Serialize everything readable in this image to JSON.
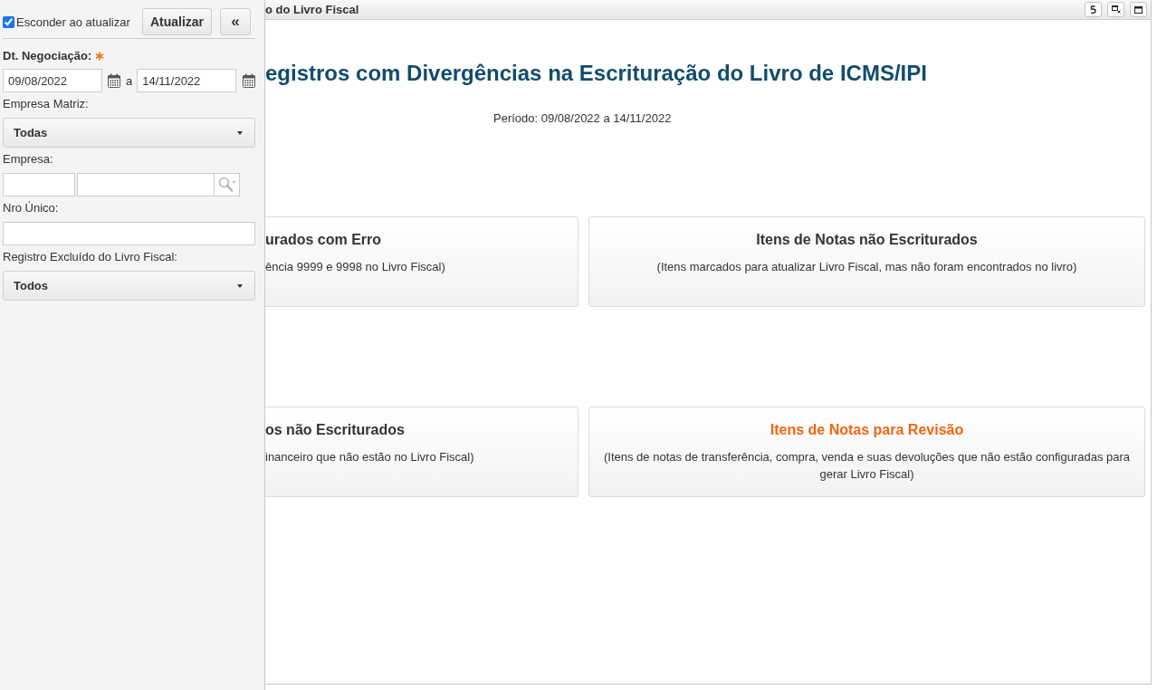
{
  "sidebar": {
    "hide_on_update": {
      "label": "Esconder ao atualizar",
      "checked": true
    },
    "update_button": "Atualizar",
    "collapse_button": "«",
    "fields": [
      {
        "kind": "date_range",
        "label": "Dt. Negociação:",
        "required": true,
        "from": "09/08/2022",
        "separator": "a",
        "to": "14/11/2022"
      },
      {
        "kind": "select",
        "label": "Empresa Matriz:",
        "required": false,
        "value": "Todas"
      },
      {
        "kind": "lookup",
        "label": "Empresa:",
        "required": false
      },
      {
        "kind": "text",
        "label": "Nro Único:",
        "required": false
      },
      {
        "kind": "select",
        "label": "Registro Excluído do Livro Fiscal:",
        "required": false,
        "value": "Todos"
      }
    ]
  },
  "window": {
    "title": "o do Livro Fiscal"
  },
  "report": {
    "title": "egistros com Divergências na Escrituração do Livro de ICMS/IPI",
    "period": "Período: 09/08/2022 a 14/11/2022",
    "cards": [
      {
        "title": "urados com Erro",
        "description": "ência 9999 e 9998 no Livro Fiscal)",
        "highlighted": false
      },
      {
        "title": "Itens de Notas não Escriturados",
        "description": "(Itens marcados para atualizar Livro Fiscal, mas não foram encontrados no livro)",
        "highlighted": false
      },
      {
        "title": "os não Escriturados",
        "description": "inanceiro que não estão no Livro Fiscal)",
        "highlighted": false
      },
      {
        "title": "Itens de Notas para Revisão",
        "description": "(Itens de notas de transferência, compra, venda e suas devoluções que não estão configuradas para gerar Livro Fiscal)",
        "highlighted": true
      }
    ]
  }
}
